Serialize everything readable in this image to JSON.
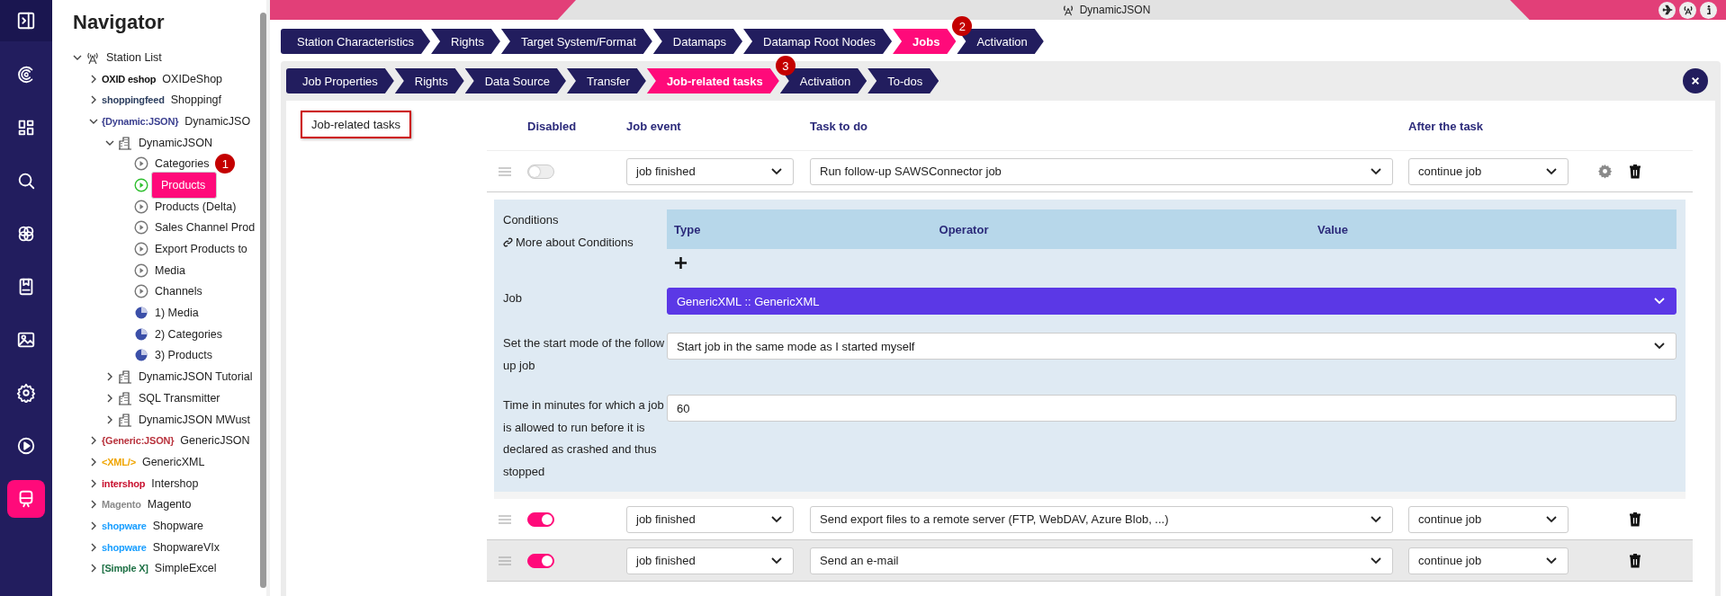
{
  "rail": [
    {
      "kind": "panel",
      "selected": false
    },
    {
      "kind": "logo",
      "selected": false
    },
    {
      "kind": "dashboard",
      "selected": false
    },
    {
      "kind": "search",
      "selected": false
    },
    {
      "kind": "links",
      "selected": false
    },
    {
      "kind": "book",
      "selected": false
    },
    {
      "kind": "image",
      "selected": false
    },
    {
      "kind": "settings",
      "selected": false
    },
    {
      "kind": "play",
      "selected": false
    },
    {
      "kind": "train",
      "selected": true
    }
  ],
  "navigator": {
    "title": "Navigator",
    "tree": [
      {
        "label": "Station List",
        "kind": "station",
        "expanded": true,
        "children": [
          {
            "label": "OXIDeShop",
            "kind": "shop",
            "logo": "OXID eshop",
            "color": "#111111",
            "expanded": false
          },
          {
            "label": "Shoppingf",
            "kind": "shop",
            "logo": "shoppingfeed",
            "color": "#2c3e5f",
            "expanded": false
          },
          {
            "label": "DynamicJSO",
            "kind": "shop",
            "logo": "{Dynamic:JSON}",
            "color": "#3a3f8f",
            "expanded": true,
            "children": [
              {
                "label": "DynamicJSON",
                "kind": "building",
                "expanded": true,
                "children": [
                  {
                    "label": "Categories",
                    "kind": "job",
                    "selected": false,
                    "badge": "1"
                  },
                  {
                    "label": "Products",
                    "kind": "job",
                    "selected": true
                  },
                  {
                    "label": "Products (Delta)",
                    "kind": "job",
                    "selected": false
                  },
                  {
                    "label": "Sales Channel Prod",
                    "kind": "job",
                    "selected": false
                  },
                  {
                    "label": "Export Products to",
                    "kind": "job",
                    "selected": false
                  },
                  {
                    "label": "Media",
                    "kind": "job",
                    "selected": false
                  },
                  {
                    "label": "Channels",
                    "kind": "job",
                    "selected": false
                  },
                  {
                    "label": "1) Media",
                    "kind": "jobgroup",
                    "selected": false
                  },
                  {
                    "label": "2) Categories",
                    "kind": "jobgroup",
                    "selected": false
                  },
                  {
                    "label": "3) Products",
                    "kind": "jobgroup",
                    "selected": false
                  }
                ]
              },
              {
                "label": "DynamicJSON Tutorial",
                "kind": "building",
                "expanded": false
              },
              {
                "label": "SQL Transmitter",
                "kind": "building",
                "expanded": false
              },
              {
                "label": "DynamicJSON MWust",
                "kind": "building",
                "expanded": false
              }
            ]
          },
          {
            "label": "GenericJSON",
            "kind": "shop",
            "logo": "{Generic:JSON}",
            "color": "#b8323c",
            "expanded": false
          },
          {
            "label": "GenericXML",
            "kind": "shop",
            "logo": "<XML/>",
            "color": "#f0a500",
            "expanded": false
          },
          {
            "label": "Intershop",
            "kind": "shop",
            "logo": "intershop",
            "color": "#c8102e",
            "expanded": false
          },
          {
            "label": "Magento",
            "kind": "shop",
            "logo": "Magento",
            "color": "#8a8a8a",
            "expanded": false
          },
          {
            "label": "Shopware",
            "kind": "shop",
            "logo": "shopware",
            "color": "#189eff",
            "expanded": false
          },
          {
            "label": "ShopwareVIx",
            "kind": "shop",
            "logo": "shopware",
            "color": "#189eff",
            "expanded": false
          },
          {
            "label": "SimpleExcel",
            "kind": "shop",
            "logo": "[Simple X]",
            "color": "#1d7044",
            "expanded": false
          }
        ]
      }
    ]
  },
  "title_bar": {
    "title": "DynamicJSON"
  },
  "main_tabs": [
    {
      "label": "Station Characteristics",
      "selected": false
    },
    {
      "label": "Rights",
      "selected": false
    },
    {
      "label": "Target System/Format",
      "selected": false
    },
    {
      "label": "Datamaps",
      "selected": false
    },
    {
      "label": "Datamap Root Nodes",
      "selected": false
    },
    {
      "label": "Jobs",
      "selected": true,
      "badge": "2"
    },
    {
      "label": "Activation",
      "selected": false
    }
  ],
  "job_tabs": [
    {
      "label": "Job Properties",
      "selected": false
    },
    {
      "label": "Rights",
      "selected": false
    },
    {
      "label": "Data Source",
      "selected": false
    },
    {
      "label": "Transfer",
      "selected": false
    },
    {
      "label": "Job-related tasks",
      "selected": true,
      "badge": "3"
    },
    {
      "label": "Activation",
      "selected": false
    },
    {
      "label": "To-dos",
      "selected": false
    }
  ],
  "section_label": "Job-related tasks",
  "columns": [
    "Disabled",
    "Job event",
    "Task to do",
    "After the task"
  ],
  "rows": [
    {
      "on": false,
      "job_event": "job finished",
      "task": "Run follow-up SAWSConnector job",
      "after": "continue job",
      "expanded": true,
      "hovered": false
    },
    {
      "on": true,
      "job_event": "job finished",
      "task": "Send export files to a remote server (FTP, WebDAV, Azure Blob, ...)",
      "after": "continue job",
      "expanded": false,
      "hovered": false
    },
    {
      "on": true,
      "job_event": "job finished",
      "task": "Send an e-mail",
      "after": "continue job",
      "expanded": false,
      "hovered": true
    }
  ],
  "details": {
    "conditions_label": "Conditions",
    "conditions_link": "More about Conditions",
    "condition_columns": [
      "Type",
      "Operator",
      "Value"
    ],
    "fields": [
      {
        "label": "Job",
        "kind": "select",
        "value": "GenericXML :: GenericXML",
        "focused": true
      },
      {
        "label": "Set the start mode of the follow up job",
        "kind": "select",
        "value": "Start job in the same mode as I started myself",
        "focused": false
      },
      {
        "label": "Time in minutes for which a job is allowed to run before it is declared as crashed and thus stopped",
        "kind": "input",
        "value": "60",
        "focused": false
      }
    ]
  }
}
